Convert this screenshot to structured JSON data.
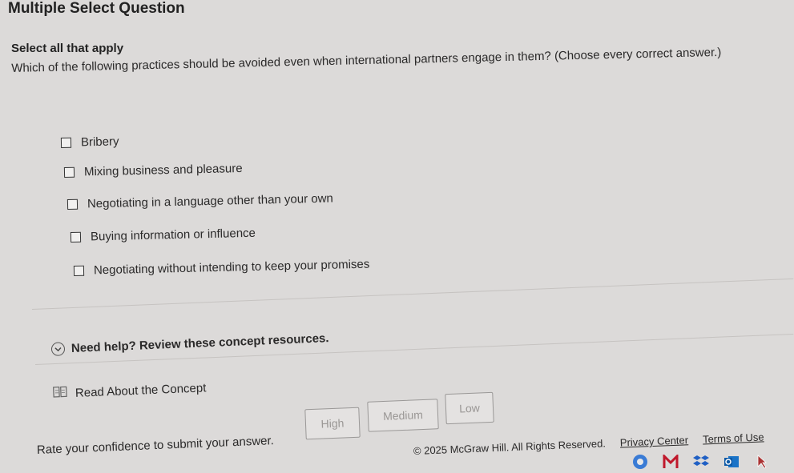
{
  "question": {
    "heading": "Multiple Select Question",
    "instruction": "Select all that apply",
    "prompt": "Which of the following practices should be avoided even when international partners engage in them? (Choose every correct answer.)"
  },
  "options": [
    {
      "label": "Bribery",
      "checked": false
    },
    {
      "label": "Mixing business and pleasure",
      "checked": false
    },
    {
      "label": "Negotiating in a language other than your own",
      "checked": false
    },
    {
      "label": "Buying information or influence",
      "checked": false
    },
    {
      "label": "Negotiating without intending to keep your promises",
      "checked": false
    }
  ],
  "help": {
    "label": "Need help? Review these concept resources.",
    "resource_label": "Read About the Concept"
  },
  "confidence": {
    "prompt": "Rate your confidence to submit your answer.",
    "high": "High",
    "medium": "Medium",
    "low": "Low"
  },
  "footer": {
    "copyright": "© 2025 McGraw Hill. All Rights Reserved.",
    "privacy": "Privacy Center",
    "terms": "Terms of Use"
  },
  "taskbar": {
    "icons": [
      "chrome-icon",
      "mcgraw-hill-icon",
      "dropbox-icon",
      "outlook-icon",
      "cursor-icon"
    ],
    "colors": {
      "mcgraw": "#c0182b",
      "dropbox": "#1f5fc4",
      "outlook": "#1a73c7"
    }
  }
}
